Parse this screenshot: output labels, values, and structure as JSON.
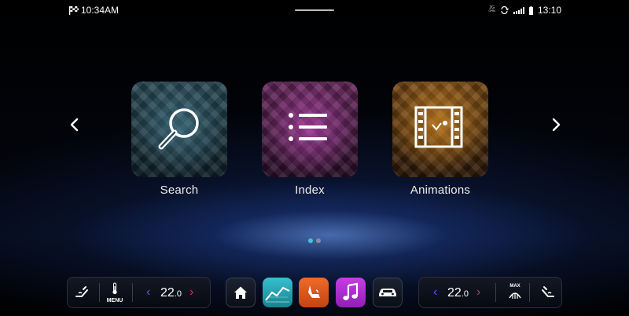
{
  "status": {
    "left_time": "10:34AM",
    "right_time": "13:10",
    "net_top": "2G",
    "net_bottom": "ᴳᴾᴿˢ"
  },
  "apps": [
    {
      "label": "Search",
      "icon": "magnifier-icon",
      "color": "#2b4d59"
    },
    {
      "label": "Index",
      "icon": "list-icon",
      "color": "#6a2860"
    },
    {
      "label": "Animations",
      "icon": "film-icon",
      "color": "#7a4a14"
    }
  ],
  "pager": {
    "pages": 2,
    "active": 1,
    "active_color": "#3ec6d8"
  },
  "climate": {
    "left_temp": "22.0",
    "right_temp": "22.0",
    "menu_label": "MENU",
    "max_label": "MAX",
    "chevron_left": "‹",
    "chevron_right": "›",
    "accent_left": "#3b63ff",
    "accent_right": "#d0307a"
  },
  "dock": [
    {
      "name": "home",
      "color": "#1a1f2c"
    },
    {
      "name": "navigation",
      "color": "#2aa7b5"
    },
    {
      "name": "seat",
      "color": "#e35a1a"
    },
    {
      "name": "music",
      "color": "#b42fd6"
    },
    {
      "name": "vehicle",
      "color": "#1a1f2c"
    }
  ]
}
